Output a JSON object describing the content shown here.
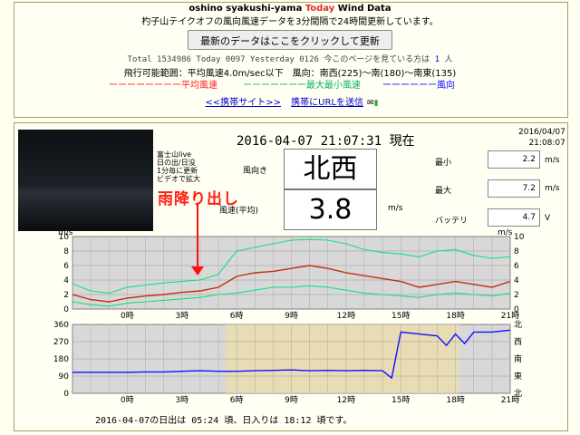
{
  "header": {
    "title_pre": "oshino syakushi-yama ",
    "title_today": "Today",
    "title_post": " Wind Data",
    "subtitle": "杓子山テイクオフの風向風速データを3分間隔で24時間更新しています。",
    "refresh_button": "最新のデータはここをクリックして更新",
    "counter_total_label": "Total",
    "counter_total": "1534986",
    "counter_today_label": "Today",
    "counter_today": "0097",
    "counter_yesterday_label": "Yesterday",
    "counter_yesterday": "0126",
    "viewers_label": "今このページを見ている方は",
    "viewers_count": "1",
    "viewers_unit": "人",
    "range_text": "飛行可能範囲：平均風速4.0m/sec以下　風向：南西(225)〜南(180)〜南東(135)",
    "legend_avg": "ーーーーーーーー平均風速",
    "legend_maxmin": "ーーーーーーー最大最小風速",
    "legend_dir": "ーーーーーー風向",
    "link_mobile": "<<携帯サイト>>",
    "link_send_url": "携帯にURLを送信"
  },
  "colors": {
    "avg": "#c03010",
    "maxmin": "#10e080",
    "dir": "#1010ff",
    "rain_label": "#ff2010"
  },
  "camera": {
    "overlay_lines": [
      "富士山live",
      "日の出/日没",
      "1分毎に更新",
      "ビデオで拡大"
    ]
  },
  "annotation": {
    "rain_text": "雨降り出し"
  },
  "current": {
    "timestamp": "2016-04-07 21:07:31 現在",
    "date": "2016/04/07",
    "time": "21:08:07",
    "dir_label": "風向き",
    "dir_value": "北西",
    "speed_label": "風速(平均)",
    "speed_value": "3.8",
    "speed_unit": "m/s",
    "min_label": "最小",
    "min_value": "2.2",
    "min_unit": "m/s",
    "max_label": "最大",
    "max_value": "7.2",
    "max_unit": "m/s",
    "battery_label": "バッテリ",
    "battery_value": "4.7",
    "battery_unit": "V"
  },
  "chart_data": [
    {
      "type": "line",
      "title": "",
      "ylabel": "m/s",
      "ylim": [
        0,
        10
      ],
      "yticks": [
        0,
        2,
        4,
        6,
        8,
        10
      ],
      "xlabels": [
        "0時",
        "3時",
        "6時",
        "9時",
        "12時",
        "15時",
        "18時",
        "21時"
      ],
      "xrange_hours": [
        -3,
        21
      ],
      "series": [
        {
          "name": "平均風速",
          "color": "#c03010",
          "x": [
            -3,
            -2,
            -1,
            0,
            1,
            2,
            3,
            4,
            5,
            6,
            7,
            8,
            9,
            10,
            11,
            12,
            13,
            14,
            15,
            16,
            17,
            18,
            19,
            20,
            21
          ],
          "y": [
            2.0,
            1.3,
            1.0,
            1.5,
            1.8,
            2.0,
            2.3,
            2.5,
            3.0,
            4.5,
            5.0,
            5.2,
            5.6,
            6.0,
            5.6,
            5.0,
            4.6,
            4.2,
            3.8,
            3.0,
            3.4,
            3.8,
            3.4,
            3.0,
            3.8
          ]
        },
        {
          "name": "最大風速",
          "x": [
            -3,
            -2,
            -1,
            0,
            1,
            2,
            3,
            4,
            5,
            6,
            7,
            8,
            9,
            10,
            11,
            12,
            13,
            14,
            15,
            16,
            17,
            18,
            19,
            20,
            21
          ],
          "y": [
            3.5,
            2.5,
            2.2,
            3.0,
            3.3,
            3.6,
            3.8,
            4.0,
            4.8,
            8.0,
            8.5,
            9.0,
            9.5,
            9.6,
            9.5,
            9.0,
            8.2,
            7.8,
            7.6,
            7.2,
            8.0,
            8.2,
            7.4,
            7.0,
            7.2
          ]
        },
        {
          "name": "最小風速",
          "x": [
            -3,
            -2,
            -1,
            0,
            1,
            2,
            3,
            4,
            5,
            6,
            7,
            8,
            9,
            10,
            11,
            12,
            13,
            14,
            15,
            16,
            17,
            18,
            19,
            20,
            21
          ],
          "y": [
            1.0,
            0.6,
            0.4,
            0.8,
            1.0,
            1.2,
            1.4,
            1.6,
            2.0,
            2.2,
            2.6,
            3.0,
            3.0,
            3.2,
            3.0,
            2.6,
            2.2,
            2.0,
            1.8,
            1.6,
            2.0,
            2.2,
            2.0,
            1.8,
            2.2
          ]
        }
      ]
    },
    {
      "type": "line",
      "title": "",
      "ylim": [
        0,
        360
      ],
      "yticks": [
        0,
        90,
        180,
        270,
        360
      ],
      "yticks_right": [
        "北",
        "東",
        "南",
        "西",
        "北"
      ],
      "xlabels": [
        "0時",
        "3時",
        "6時",
        "9時",
        "12時",
        "15時",
        "18時",
        "21時"
      ],
      "xrange_hours": [
        -3,
        21
      ],
      "series": [
        {
          "name": "風向",
          "color": "#1010ff",
          "x": [
            -3,
            -2,
            -1,
            0,
            1,
            2,
            3,
            4,
            5,
            6,
            7,
            8,
            9,
            10,
            11,
            12,
            13,
            14,
            14.5,
            15,
            16,
            17,
            17.5,
            18,
            18.5,
            19,
            20,
            21
          ],
          "y": [
            110,
            110,
            110,
            110,
            112,
            112,
            115,
            118,
            115,
            115,
            118,
            120,
            122,
            118,
            120,
            118,
            120,
            118,
            80,
            320,
            310,
            300,
            250,
            310,
            260,
            320,
            320,
            330
          ]
        }
      ]
    }
  ],
  "footer": {
    "sunrise_text": "2016-04-07の日出は 05:24 頃、日入りは 18:12 頃です。"
  }
}
